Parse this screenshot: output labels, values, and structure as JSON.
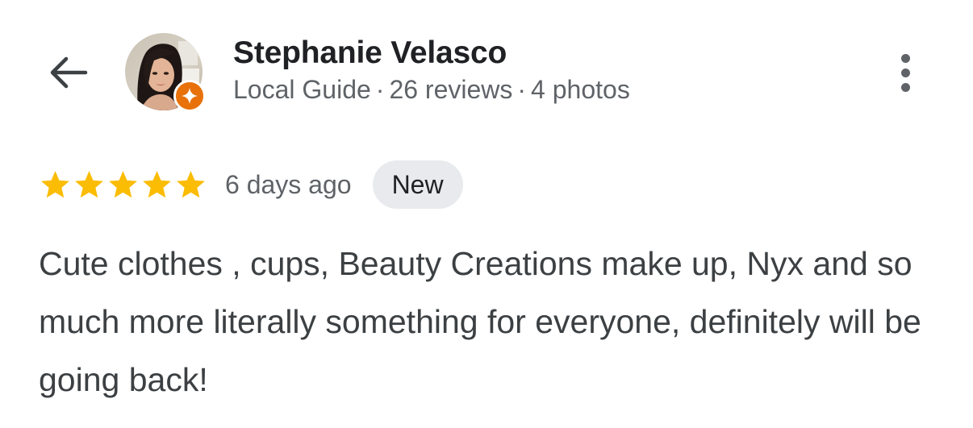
{
  "header": {
    "back_icon": "arrow-back-icon",
    "more_icon": "more-vertical-icon"
  },
  "reviewer": {
    "name": "Stephanie Velasco",
    "level": "Local Guide",
    "separator": "·",
    "reviews": "26 reviews",
    "photos": "4 photos",
    "avatar_icon": "profile-photo",
    "badge_icon": "local-guide-badge-icon",
    "badge_color": "#e8710a"
  },
  "review": {
    "rating": 5,
    "rating_max": 5,
    "star_color": "#fbbc04",
    "time": "6 days ago",
    "badge": "New",
    "text": "Cute clothes , cups, Beauty Creations make up, Nyx and so much more literally something for everyone, definitely will be going back!"
  }
}
